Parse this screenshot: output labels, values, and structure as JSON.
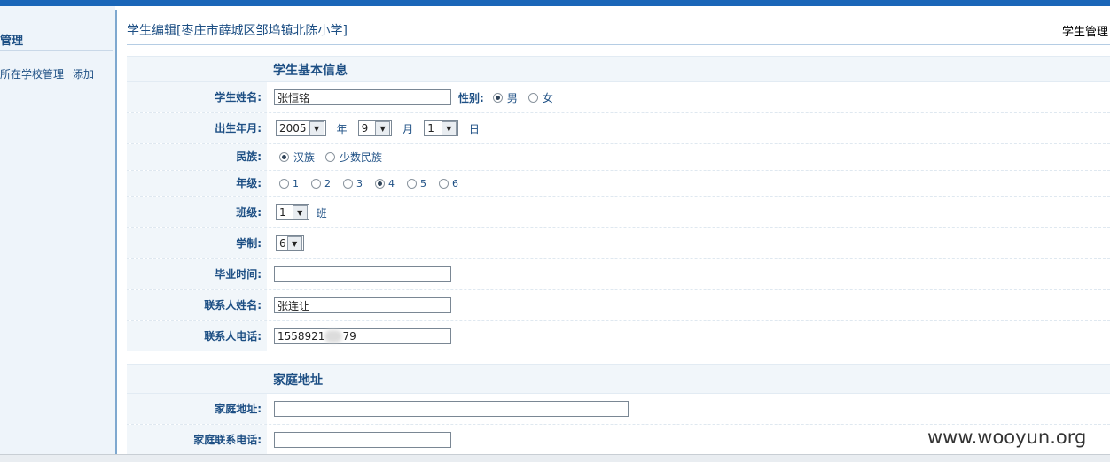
{
  "sidebar": {
    "title": "管理",
    "link_manage": "所在学校管理",
    "link_add": "添加"
  },
  "header": {
    "title": "学生编辑[枣庄市薛城区邹坞镇北陈小学]",
    "right": "学生管理"
  },
  "sections": {
    "basic": "学生基本信息",
    "address": "家庭地址"
  },
  "fields": {
    "name": {
      "label": "学生姓名:",
      "value": "张恒铭"
    },
    "gender": {
      "label": "性别:",
      "options": [
        "男",
        "女"
      ],
      "selected": "男"
    },
    "birth": {
      "label": "出生年月:",
      "year": "2005",
      "year_unit": "年",
      "month": "9",
      "month_unit": "月",
      "day": "1",
      "day_unit": "日"
    },
    "ethnicity": {
      "label": "民族:",
      "options": [
        "汉族",
        "少数民族"
      ],
      "selected": "汉族"
    },
    "grade": {
      "label": "年级:",
      "options": [
        "1",
        "2",
        "3",
        "4",
        "5",
        "6"
      ],
      "selected": "4"
    },
    "class": {
      "label": "班级:",
      "value": "1",
      "unit": "班"
    },
    "system": {
      "label": "学制:",
      "value": "6"
    },
    "graduation": {
      "label": "毕业时间:",
      "value": ""
    },
    "contact_name": {
      "label": "联系人姓名:",
      "value": "张连让"
    },
    "contact_phone": {
      "label": "联系人电话:",
      "value_prefix": "1558921",
      "value_suffix": "79"
    },
    "home_address": {
      "label": "家庭地址:",
      "value": ""
    },
    "home_phone": {
      "label": "家庭联系电话:",
      "value": ""
    }
  },
  "watermark": "www.wooyun.org"
}
